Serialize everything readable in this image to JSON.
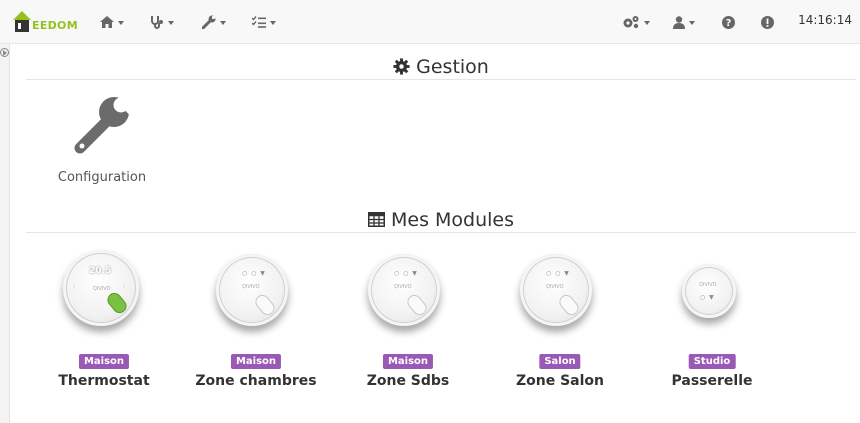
{
  "brand": {
    "name": "EEDOM",
    "accent": "#94c11f"
  },
  "navbar": {
    "left_menus": [
      {
        "icon": "home-icon"
      },
      {
        "icon": "stethoscope-icon"
      },
      {
        "icon": "wrench-icon"
      },
      {
        "icon": "tasks-icon"
      }
    ],
    "right_menus": [
      {
        "icon": "cogs-icon"
      },
      {
        "icon": "user-icon"
      },
      {
        "icon": "question-icon"
      },
      {
        "icon": "alert-icon"
      }
    ],
    "clock": "14:16:14"
  },
  "gestion": {
    "title": "Gestion",
    "icon": "gear-icon",
    "tiles": [
      {
        "label": "Configuration",
        "icon": "wrench-icon"
      }
    ]
  },
  "modules": {
    "title": "Mes Modules",
    "icon": "table-icon",
    "badge_color": "#9b59b6",
    "items": [
      {
        "room": "Maison",
        "name": "Thermostat"
      },
      {
        "room": "Maison",
        "name": "Zone chambres"
      },
      {
        "room": "Maison",
        "name": "Zone Sdbs"
      },
      {
        "room": "Salon",
        "name": "Zone Salon"
      },
      {
        "room": "Studio",
        "name": "Passerelle"
      }
    ]
  }
}
